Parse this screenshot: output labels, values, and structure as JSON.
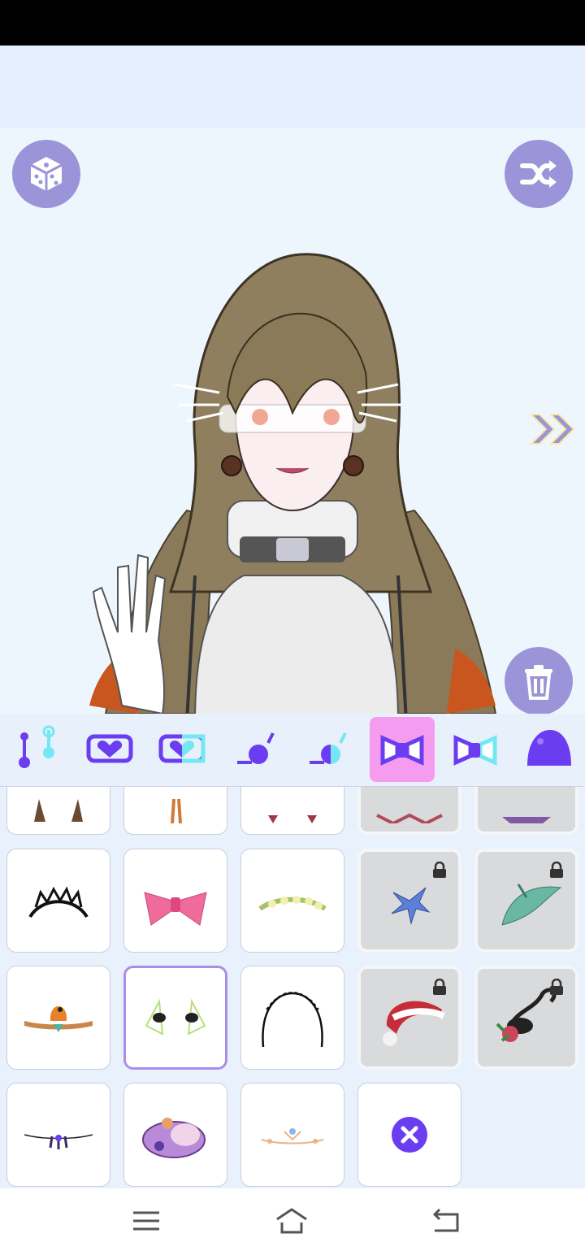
{
  "app": {
    "name": "avatar-dress-up"
  },
  "colors": {
    "accent": "#9b94d8",
    "tab_active": "#f59cf0",
    "icon_purple": "#6a3df0",
    "icon_cyan": "#73e8f3",
    "locked_bg": "#d8dadb",
    "selected_border": "#a98ee8"
  },
  "toolbar": {
    "dice_icon": "dice-icon",
    "shuffle_icon": "shuffle-icon",
    "trash_icon": "trash-icon",
    "next_icon": "double-chevron-right-icon"
  },
  "tabs": [
    {
      "id": "pose",
      "icon": "pose-lines-icon"
    },
    {
      "id": "mouth-full",
      "icon": "heart-mouth-icon"
    },
    {
      "id": "mouth-half",
      "icon": "heart-mouth-half-icon"
    },
    {
      "id": "eyes-full",
      "icon": "eye-lash-icon"
    },
    {
      "id": "eyes-half",
      "icon": "eye-lash-half-icon"
    },
    {
      "id": "hair-accessory",
      "icon": "bow-icon",
      "active": true
    },
    {
      "id": "hair-accessory-half",
      "icon": "bow-half-icon"
    },
    {
      "id": "hat",
      "icon": "slime-hat-icon"
    }
  ],
  "items": [
    {
      "name": "horns-brown",
      "locked": false
    },
    {
      "name": "braids-orange",
      "locked": false
    },
    {
      "name": "horns-red",
      "locked": false
    },
    {
      "name": "cat-ears-red",
      "locked": true
    },
    {
      "name": "bow-purple",
      "locked": true
    },
    {
      "name": "black-tiara",
      "locked": false
    },
    {
      "name": "pink-bow",
      "locked": false
    },
    {
      "name": "flower-crown",
      "locked": false
    },
    {
      "name": "blue-flower",
      "locked": true
    },
    {
      "name": "green-leaf",
      "locked": true
    },
    {
      "name": "bird-branch",
      "locked": false
    },
    {
      "name": "vr-earpieces",
      "locked": false,
      "selected": true
    },
    {
      "name": "black-headband",
      "locked": false
    },
    {
      "name": "santa-hat",
      "locked": true
    },
    {
      "name": "scorpion-rose",
      "locked": true
    },
    {
      "name": "bead-chain",
      "locked": false
    },
    {
      "name": "purple-shell-hat",
      "locked": false
    },
    {
      "name": "gold-circlet",
      "locked": false
    },
    {
      "name": "remove-accessory",
      "locked": false
    }
  ],
  "navbar": {
    "menu_icon": "menu-icon",
    "home_icon": "home-icon",
    "back_icon": "back-icon"
  }
}
